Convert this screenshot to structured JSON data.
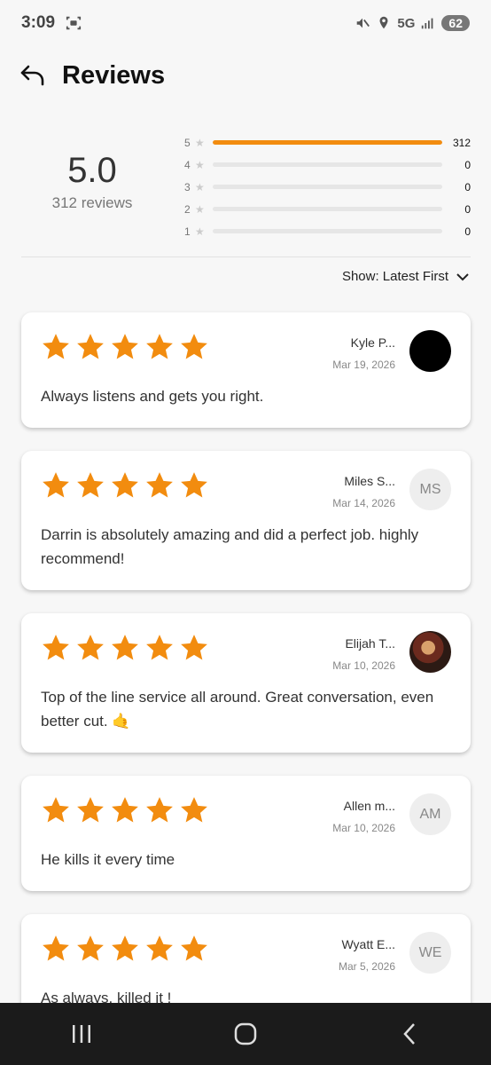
{
  "status_bar": {
    "time": "3:09",
    "network": "5G",
    "battery": "62"
  },
  "header": {
    "title": "Reviews"
  },
  "summary": {
    "average": "5.0",
    "count_text": "312 reviews",
    "distribution": [
      {
        "stars": "5",
        "count": "312",
        "fraction": 1.0
      },
      {
        "stars": "4",
        "count": "0",
        "fraction": 0
      },
      {
        "stars": "3",
        "count": "0",
        "fraction": 0
      },
      {
        "stars": "2",
        "count": "0",
        "fraction": 0
      },
      {
        "stars": "1",
        "count": "0",
        "fraction": 0
      }
    ]
  },
  "sort": {
    "label": "Show: Latest First"
  },
  "reviews": [
    {
      "name": "Kyle P...",
      "date": "Mar 19, 2026",
      "initials": "",
      "text": "Always listens and gets you right.",
      "rating": 5
    },
    {
      "name": "Miles S...",
      "date": "Mar 14, 2026",
      "initials": "MS",
      "text": "Darrin is absolutely amazing and did a perfect job. highly recommend!",
      "rating": 5
    },
    {
      "name": "Elijah T...",
      "date": "Mar 10, 2026",
      "initials": "",
      "text": "Top of the line service all around. Great conversation, even better cut. 🤙",
      "rating": 5
    },
    {
      "name": "Allen m...",
      "date": "Mar 10, 2026",
      "initials": "AM",
      "text": "He kills it every time",
      "rating": 5
    },
    {
      "name": "Wyatt E...",
      "date": "Mar 5, 2026",
      "initials": "WE",
      "text": "As always, killed it !",
      "rating": 5
    }
  ],
  "colors": {
    "accent": "#f28c0f",
    "star": "#f28c0f"
  }
}
